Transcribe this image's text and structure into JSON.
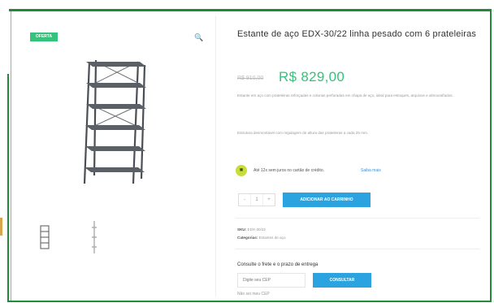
{
  "badge": {
    "label": "OFERTA"
  },
  "icons": {
    "zoom": "magnifier-icon",
    "credit": "credit-card-icon"
  },
  "product": {
    "title": "Estante de aço EDX-30/22 linha pesado com 6 prateleiras",
    "price_old": "R$ 910,00",
    "price_new": "R$ 829,00",
    "description_1": "Estante em aço com prateleiras reforçadas e colunas perfuradas em chapa de aço, ideal para estoques, arquivos e almoxarifados.",
    "description_2": "Estrutura desmontável com regulagem de altura das prateleiras a cada 25 mm.",
    "credit_text": "Até 12x sem juros no cartão de crédito.",
    "credit_link": "Saiba mais",
    "quantity": "1",
    "qty_minus": "-",
    "qty_plus": "+",
    "add_to_cart": "ADICIONAR AO CARRINHO",
    "sku_label": "SKU:",
    "sku_value": "EDX-30/22",
    "category_label": "Categorias:",
    "category_value": "Estantes de aço",
    "shipping_title": "Consulte o frete e o prazo de entrega",
    "cep_placeholder": "Digite seu CEP",
    "cep_button": "CONSULTAR",
    "cep_link": "Não sei meu CEP"
  },
  "colors": {
    "frame": "#1e8a3a",
    "accent_green": "#35c27b",
    "button_blue": "#2aa3e0",
    "credit_icon": "#c9dc3a"
  }
}
